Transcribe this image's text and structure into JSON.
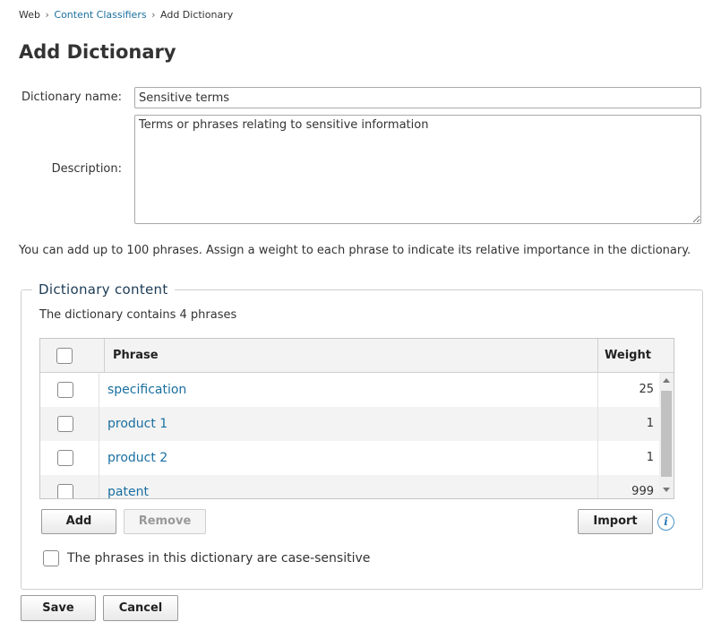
{
  "breadcrumb": {
    "root": "Web",
    "separator": "›",
    "parent": "Content Classifiers",
    "current": "Add Dictionary"
  },
  "page_title": "Add Dictionary",
  "form": {
    "name_label": "Dictionary name:",
    "name_value": "Sensitive terms",
    "description_label": "Description:",
    "description_value": "Terms or phrases relating to sensitive information"
  },
  "info_text": "You can add up to 100 phrases. Assign a weight to each phrase to indicate its relative importance in the dictionary.",
  "dictionary_content": {
    "legend": "Dictionary content",
    "count_text": "The dictionary contains 4 phrases",
    "columns": {
      "phrase": "Phrase",
      "weight": "Weight"
    },
    "rows": [
      {
        "phrase": "specification",
        "weight": "25"
      },
      {
        "phrase": "product 1",
        "weight": "1"
      },
      {
        "phrase": "product 2",
        "weight": "1"
      },
      {
        "phrase": "patent",
        "weight": "999"
      }
    ],
    "buttons": {
      "add": "Add",
      "remove": "Remove",
      "import": "Import"
    },
    "info_icon_glyph": "i",
    "case_sensitive_label": "The phrases in this dictionary are case-sensitive"
  },
  "footer": {
    "save": "Save",
    "cancel": "Cancel"
  },
  "colors": {
    "link": "#1a6fa0",
    "legend": "#1c3b55",
    "info_icon": "#2a78b5"
  }
}
